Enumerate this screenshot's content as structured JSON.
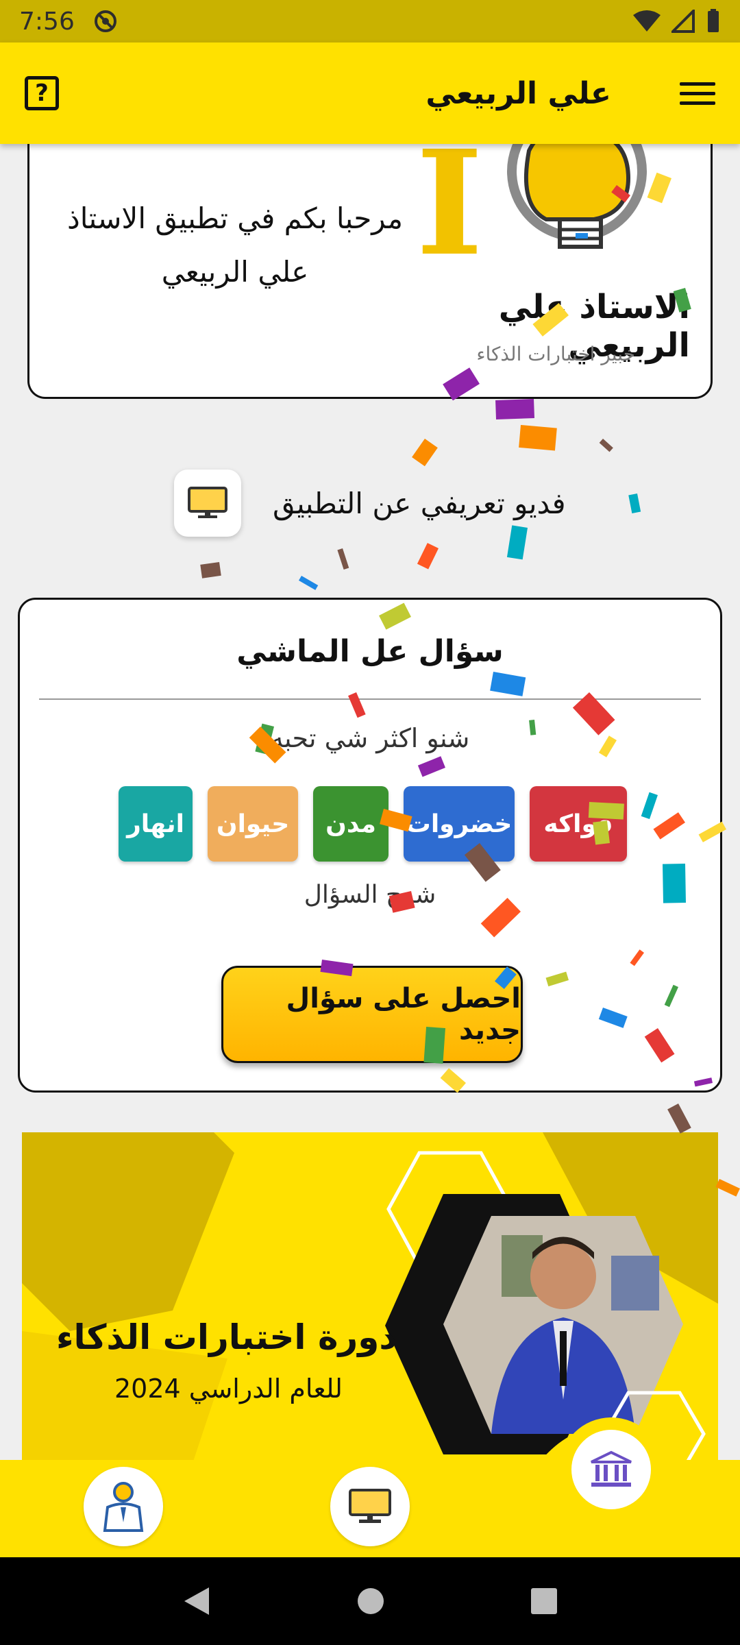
{
  "status_bar": {
    "time": "7:56"
  },
  "app_bar": {
    "title": "علي الربيعي",
    "help": "?"
  },
  "welcome": {
    "line1": "مرحبا بكم في تطبيق الاستاذ",
    "line2": "علي الربيعي",
    "logo_name": "الاستاذ علي الربيعي",
    "logo_subtitle": "خبير اختبارات الذكاء"
  },
  "intro_video": {
    "label": "فديو تعريفي عن التطبيق"
  },
  "question_card": {
    "title": "سؤال عل الماشي",
    "question": "شنو اكثر شي تحبه",
    "options": [
      {
        "label": "انهار",
        "color": "#19a7a3"
      },
      {
        "label": "حيوان",
        "color": "#f0ad5c"
      },
      {
        "label": "مدن",
        "color": "#3b9330"
      },
      {
        "label": "خضروات",
        "color": "#2e6cd1"
      },
      {
        "label": "فواكه",
        "color": "#d3363f"
      }
    ],
    "explain": "شرح السؤال",
    "new_question_button": "احصل على سؤال جديد"
  },
  "banner": {
    "title": "دورة اختبارات الذكاء",
    "subtitle": "للعام الدراسي 2024"
  },
  "bottom_nav": {
    "items": [
      "profile-icon",
      "video-icon",
      "institution-icon"
    ]
  }
}
